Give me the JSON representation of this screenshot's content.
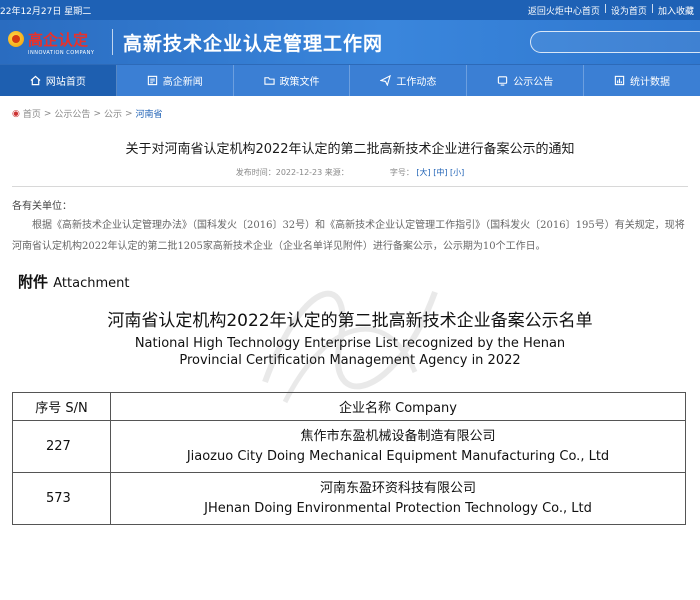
{
  "topbar": {
    "date": "22年12月27日 星期二",
    "links": [
      "返回火炬中心首页",
      "|",
      "设为首页",
      "|",
      "加入收藏"
    ]
  },
  "header": {
    "logo_text": "高企认定",
    "logo_sub": "INNOVATION COMPANY",
    "site_title": "高新技术企业认定管理工作网"
  },
  "nav": [
    {
      "label": "网站首页",
      "icon": "home-icon",
      "active": true
    },
    {
      "label": "高企新闻",
      "icon": "news-icon",
      "active": false
    },
    {
      "label": "政策文件",
      "icon": "folder-icon",
      "active": false
    },
    {
      "label": "工作动态",
      "icon": "send-icon",
      "active": false
    },
    {
      "label": "公示公告",
      "icon": "announcement-icon",
      "active": false
    },
    {
      "label": "统计数据",
      "icon": "stats-icon",
      "active": false
    }
  ],
  "breadcrumb": [
    "首页",
    "公示公告",
    "公示",
    "河南省"
  ],
  "article": {
    "title": "关于对河南省认定机构2022年认定的第二批高新技术企业进行备案公示的通知",
    "meta_date": "发布时间：2022-12-23 来源：",
    "meta_size_label": "字号：",
    "sizes": [
      "[大]",
      "[中]",
      "[小]"
    ],
    "salutation": "各有关单位：",
    "paragraph": "根据《高新技术企业认定管理办法》（国科发火〔2016〕32号）和《高新技术企业认定管理工作指引》（国科发火〔2016〕195号）有关规定，现将河南省认定机构2022年认定的第二批1205家高新技术企业（企业名单详见附件）进行备案公示，公示期为10个工作日。"
  },
  "attachment": {
    "label_cn": "附件",
    "label_en": "Attachment",
    "list_title_cn": "河南省认定机构2022年认定的第二批高新技术企业备案公示名单",
    "list_title_en_1": "National High Technology Enterprise List recognized by the Henan",
    "list_title_en_2": "Provincial Certification Management Agency in 2022"
  },
  "table": {
    "headers": {
      "sn": "序号 S/N",
      "company": "企业名称 Company"
    },
    "rows": [
      {
        "sn": "227",
        "company_cn": "焦作市东盈机械设备制造有限公司",
        "company_en": "Jiaozuo City Doing Mechanical Equipment Manufacturing Co., Ltd"
      },
      {
        "sn": "573",
        "company_cn": "河南东盈环资科技有限公司",
        "company_en": "JHenan Doing Environmental Protection Technology Co., Ltd"
      }
    ]
  },
  "colors": {
    "topbar": "#1e61b5",
    "header": "#3a86dc",
    "nav": "#3b7fd4",
    "nav_active": "#1e5fb0",
    "logo_red": "#e8312b",
    "link_blue": "#1e61b5"
  }
}
